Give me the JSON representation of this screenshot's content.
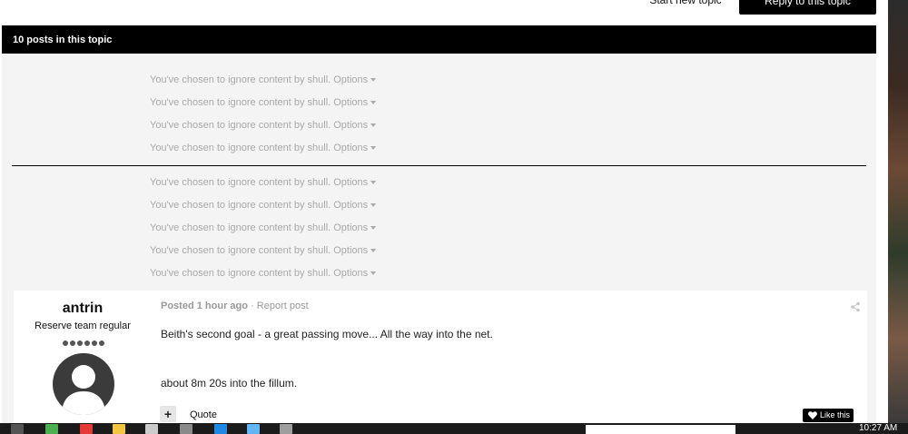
{
  "toolbar": {
    "start_new_topic_label": "Start new topic",
    "reply_label": "Reply to this topic"
  },
  "header": {
    "post_count_text": "10 posts in this topic"
  },
  "ignored_posts": {
    "group_a": [
      {
        "text": "You've chosen to ignore content by shull.",
        "options_label": "Options"
      },
      {
        "text": "You've chosen to ignore content by shull.",
        "options_label": "Options"
      },
      {
        "text": "You've chosen to ignore content by shull.",
        "options_label": "Options"
      },
      {
        "text": "You've chosen to ignore content by shull.",
        "options_label": "Options"
      }
    ],
    "group_b": [
      {
        "text": "You've chosen to ignore content by shull.",
        "options_label": "Options"
      },
      {
        "text": "You've chosen to ignore content by shull.",
        "options_label": "Options"
      },
      {
        "text": "You've chosen to ignore content by shull.",
        "options_label": "Options"
      },
      {
        "text": "You've chosen to ignore content by shull.",
        "options_label": "Options"
      },
      {
        "text": "You've chosen to ignore content by shull.",
        "options_label": "Options"
      }
    ]
  },
  "post": {
    "author_name": "antrin",
    "author_title": "Reserve team regular",
    "rank_pips": 6,
    "posted_label": "Posted",
    "posted_time": "1 hour ago",
    "separator": "·",
    "report_label": "Report post",
    "body_line1": "Beith's second goal - a great passing move...  All the way into the net.",
    "body_line2": "about 8m 20s into the fillum.",
    "plus_label": "+",
    "quote_label": "Quote",
    "like_label": "Like this"
  },
  "taskbar": {
    "clock": "10:27 AM"
  },
  "colors": {
    "header_bg": "#000000",
    "content_bg": "#f4f4f4",
    "ignored_text": "#a9a9a9"
  }
}
